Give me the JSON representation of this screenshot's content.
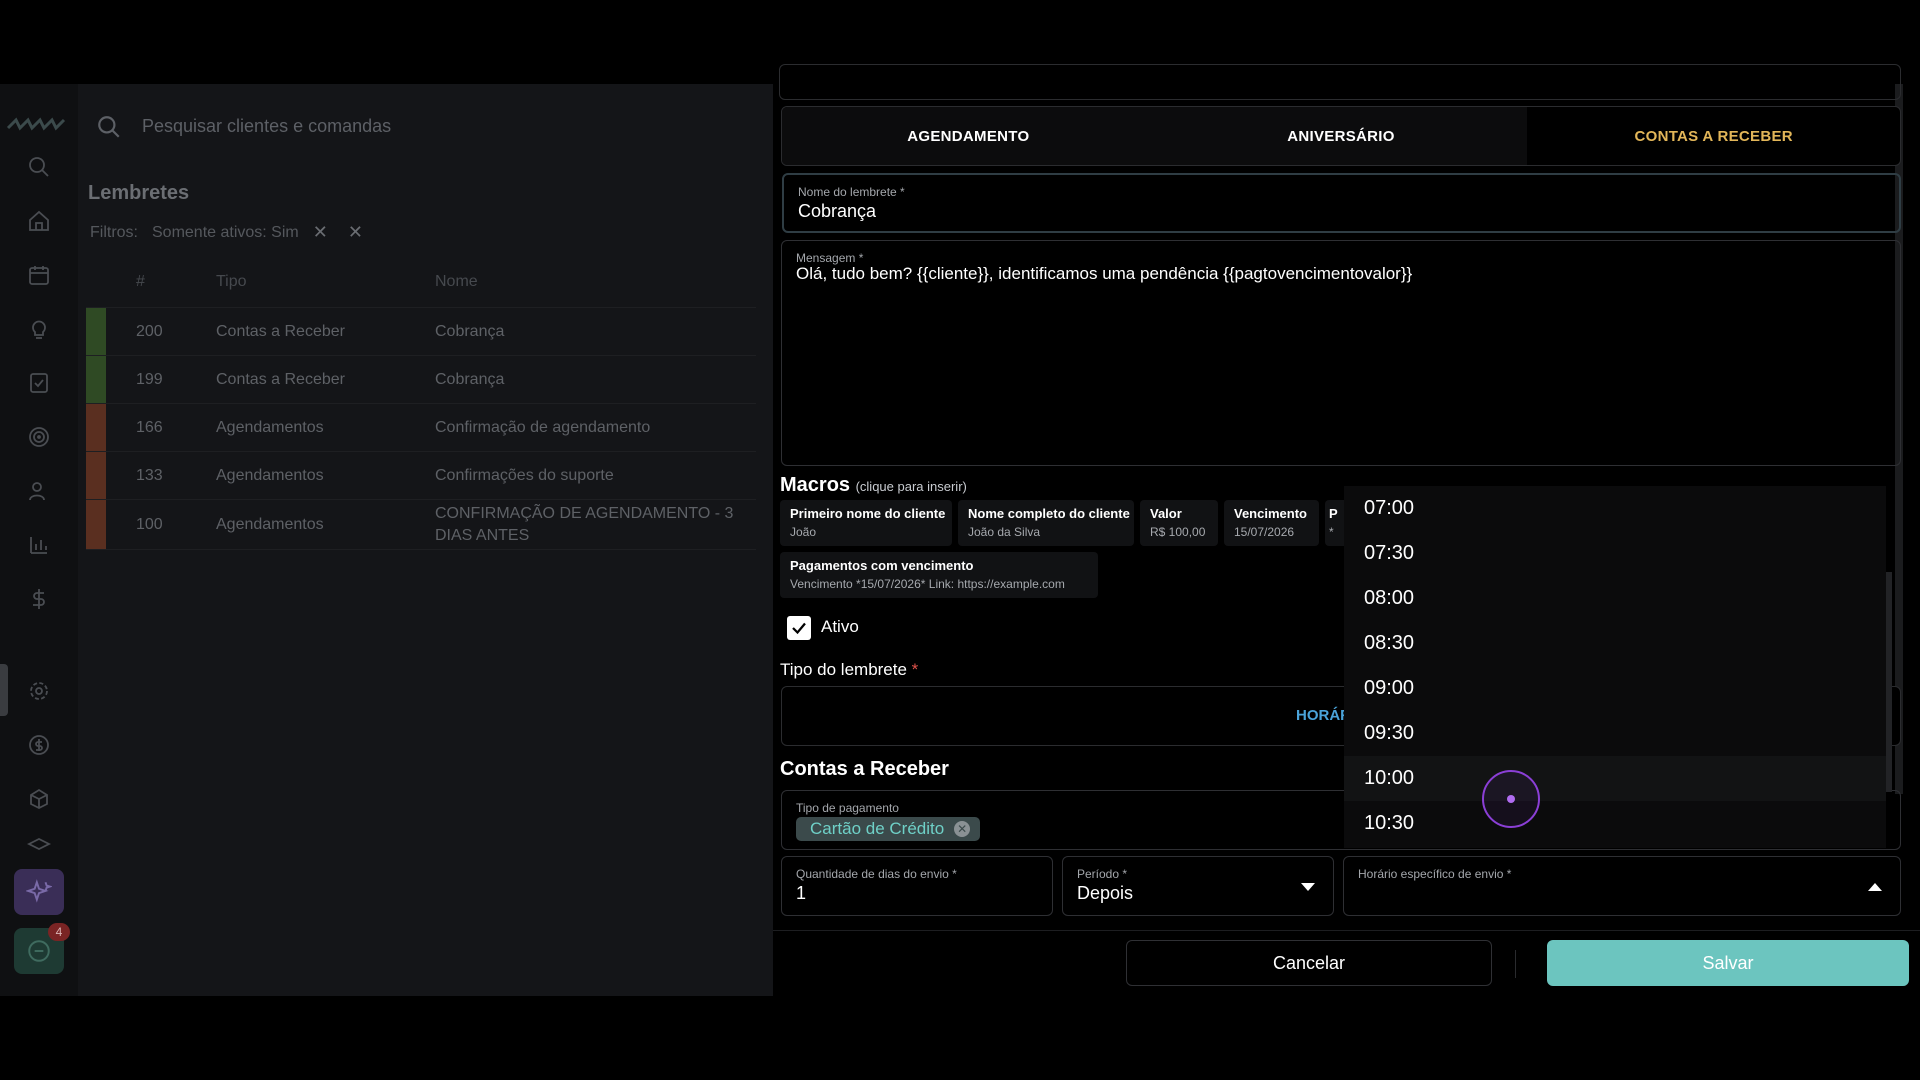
{
  "search": {
    "placeholder": "Pesquisar clientes e comandas"
  },
  "page": {
    "title": "Lembretes",
    "filters_label": "Filtros:",
    "filter_chip": "Somente ativos: Sim"
  },
  "table": {
    "headers": [
      "#",
      "Tipo",
      "Nome"
    ],
    "rows": [
      {
        "id": "200",
        "tipo": "Contas a Receber",
        "nome": "Cobrança",
        "color": "#3a5a2c"
      },
      {
        "id": "199",
        "tipo": "Contas a Receber",
        "nome": "Cobrança",
        "color": "#3a5a2c"
      },
      {
        "id": "166",
        "tipo": "Agendamentos",
        "nome": "Confirmação de agendamento",
        "color": "#6b3a26"
      },
      {
        "id": "133",
        "tipo": "Agendamentos",
        "nome": "Confirmações do suporte",
        "color": "#6b3a26"
      },
      {
        "id": "100",
        "tipo": "Agendamentos",
        "nome": "CONFIRMAÇÃO DE AGENDAMENTO - 3 DIAS ANTES",
        "color": "#6b3a26"
      }
    ]
  },
  "sidebar": {
    "chat_badge": "4"
  },
  "modal": {
    "tabs": [
      "AGENDAMENTO",
      "ANIVERSÁRIO",
      "CONTAS A RECEBER"
    ],
    "active_tab": 2,
    "nome_label": "Nome do lembrete *",
    "nome_value": "Cobrança",
    "mensagem_label": "Mensagem *",
    "mensagem_value": "Olá, tudo bem? {{cliente}}, identificamos uma pendência {{pagtovencimentovalor}}",
    "macros_title": "Macros",
    "macros_hint": "(clique para inserir)",
    "macros": [
      {
        "title": "Primeiro nome do cliente",
        "sample": "João"
      },
      {
        "title": "Nome completo do cliente",
        "sample": "João da Silva"
      },
      {
        "title": "Valor",
        "sample": "R$ 100,00"
      },
      {
        "title": "Vencimento",
        "sample": "15/07/2026"
      },
      {
        "title": "P",
        "sample": "*"
      },
      {
        "title": "Pagamentos com vencimento",
        "sample": "Vencimento *15/07/2026* Link: https://example.com"
      }
    ],
    "ativo_label": "Ativo",
    "tipo_label": "Tipo do lembrete",
    "horario_tab": "HORÁR",
    "contas_title": "Contas a Receber",
    "tipo_pagamento_label": "Tipo de pagamento",
    "tipo_pagamento_chip": "Cartão de Crédito",
    "dias_label": "Quantidade de dias do envio *",
    "dias_value": "1",
    "periodo_label": "Período *",
    "periodo_value": "Depois",
    "horario_label": "Horário específico de envio *",
    "horario_options": [
      "07:00",
      "07:30",
      "08:00",
      "08:30",
      "09:00",
      "09:30",
      "10:00",
      "10:30"
    ],
    "hovered_option": "10:00",
    "cancel_label": "Cancelar",
    "save_label": "Salvar"
  },
  "colors": {
    "accent_tab": "#e2b659",
    "save": "#6cc5bf",
    "chip_text": "#6fd0c7",
    "horario_tab": "#4aa3d9"
  }
}
